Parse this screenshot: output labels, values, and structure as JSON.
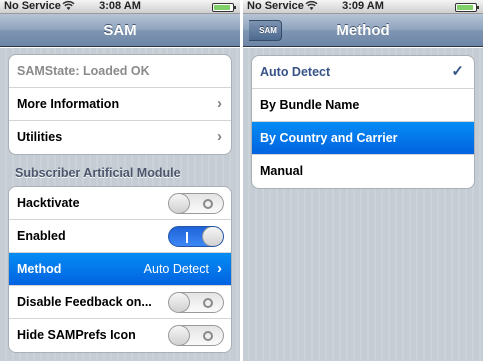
{
  "left": {
    "status": {
      "carrier": "No Service",
      "time": "3:08 AM"
    },
    "nav": {
      "title": "SAM"
    },
    "group1": [
      {
        "label": "SAMState: Loaded OK"
      },
      {
        "label": "More Information"
      },
      {
        "label": "Utilities"
      }
    ],
    "section_header": "Subscriber Artificial Module",
    "group2": [
      {
        "label": "Hacktivate",
        "switch": "off"
      },
      {
        "label": "Enabled",
        "switch": "on"
      },
      {
        "label": "Method",
        "detail": "Auto Detect"
      },
      {
        "label": "Disable Feedback on...",
        "switch": "off"
      },
      {
        "label": "Hide SAMPrefs Icon",
        "switch": "off"
      }
    ]
  },
  "right": {
    "status": {
      "carrier": "No Service",
      "time": "3:09 AM"
    },
    "nav": {
      "title": "Method",
      "back_label": "SAM"
    },
    "options": [
      {
        "label": "Auto Detect",
        "checked": true
      },
      {
        "label": "By Bundle Name"
      },
      {
        "label": "By Country and Carrier",
        "highlighted": true
      },
      {
        "label": "Manual"
      }
    ]
  },
  "icons": {
    "wifi": "wifi-icon",
    "battery": "battery-icon",
    "chevron": "chevron-right-icon",
    "checkmark": "checkmark-icon"
  },
  "colors": {
    "nav_bar": "#7f96b3",
    "selected_row": "#0263e0",
    "checked_text": "#385487",
    "switch_on": "#2f7ae8"
  }
}
